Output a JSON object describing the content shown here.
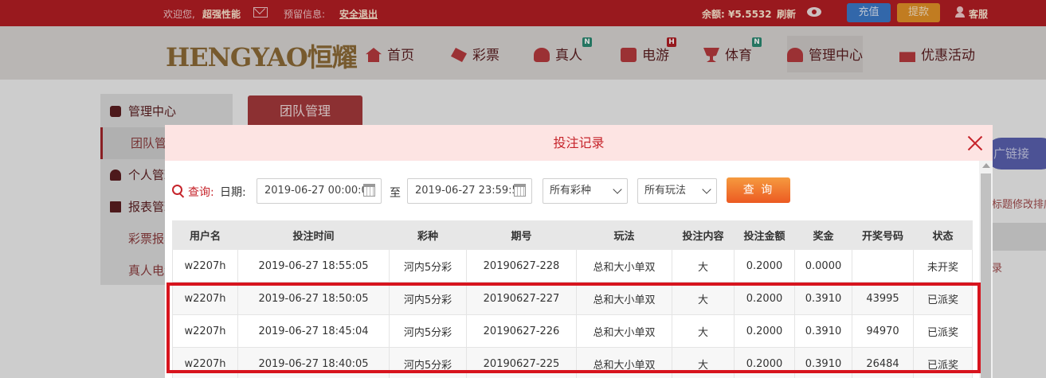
{
  "topbar": {
    "welcome": "欢迎您,",
    "username": "超强性能",
    "reserved_info": "预留信息:",
    "logout": "安全退出",
    "balance_label": "余额: ¥5.5532",
    "refresh": "刷新",
    "deposit": "充值",
    "withdraw": "提款",
    "customer_service": "客服"
  },
  "nav": {
    "logo": "HENGYAO恒耀",
    "items": [
      {
        "label": "首页"
      },
      {
        "label": "彩票"
      },
      {
        "label": "真人",
        "badge": "N"
      },
      {
        "label": "电游",
        "badge": "H"
      },
      {
        "label": "体育",
        "badge": "N"
      },
      {
        "label": "管理中心"
      },
      {
        "label": "优惠活动"
      }
    ]
  },
  "sidebar": {
    "items": [
      {
        "label": "管理中心"
      },
      {
        "label": "团队管理"
      },
      {
        "label": "个人管理"
      },
      {
        "label": "报表管理"
      },
      {
        "label": "彩票报表"
      },
      {
        "label": "真人电游"
      }
    ]
  },
  "background": {
    "tab": "团队管理",
    "promo_link": "广链接",
    "text1": "标题修改排序",
    "text2": "录"
  },
  "modal": {
    "title": "投注记录",
    "search_label": "查询:",
    "date_label": "日期:",
    "start_date": "2019-06-27 00:00:00",
    "to_label": "至",
    "end_date": "2019-06-27 23:59:59",
    "lottery_select": "所有彩种",
    "play_select": "所有玩法",
    "query_button": "查 询",
    "table": {
      "headers": [
        "用户名",
        "投注时间",
        "彩种",
        "期号",
        "玩法",
        "投注内容",
        "投注金额",
        "奖金",
        "开奖号码",
        "状态"
      ],
      "rows": [
        [
          "w2207h",
          "2019-06-27 18:55:05",
          "河内5分彩",
          "20190627-228",
          "总和大小单双",
          "大",
          "0.2000",
          "0.0000",
          "",
          "未开奖"
        ],
        [
          "w2207h",
          "2019-06-27 18:50:05",
          "河内5分彩",
          "20190627-227",
          "总和大小单双",
          "大",
          "0.2000",
          "0.3910",
          "43995",
          "已派奖"
        ],
        [
          "w2207h",
          "2019-06-27 18:45:04",
          "河内5分彩",
          "20190627-226",
          "总和大小单双",
          "大",
          "0.2000",
          "0.3910",
          "94970",
          "已派奖"
        ],
        [
          "w2207h",
          "2019-06-27 18:40:05",
          "河内5分彩",
          "20190627-225",
          "总和大小单双",
          "大",
          "0.2000",
          "0.3910",
          "26484",
          "已派奖"
        ]
      ]
    }
  },
  "colors": {
    "brand_red": "#b41e24",
    "status_pending": "#1ea03a",
    "status_paid": "#d6242a",
    "highlight": "#d7141e"
  }
}
